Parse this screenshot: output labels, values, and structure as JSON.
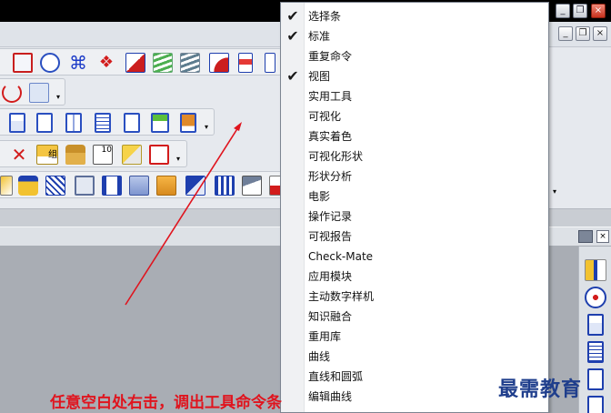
{
  "context_menu": {
    "items": [
      {
        "label": "选择条",
        "checked": true
      },
      {
        "label": "标准",
        "checked": true
      },
      {
        "label": "重复命令",
        "checked": false
      },
      {
        "label": "视图",
        "checked": true
      },
      {
        "label": "实用工具",
        "checked": false
      },
      {
        "label": "可视化",
        "checked": false
      },
      {
        "label": "真实着色",
        "checked": false
      },
      {
        "label": "可视化形状",
        "checked": false
      },
      {
        "label": "形状分析",
        "checked": false
      },
      {
        "label": "电影",
        "checked": false
      },
      {
        "label": "操作记录",
        "checked": false
      },
      {
        "label": "可视报告",
        "checked": false
      },
      {
        "label": "Check-Mate",
        "checked": false
      },
      {
        "label": "应用模块",
        "checked": false
      },
      {
        "label": "主动数字样机",
        "checked": false
      },
      {
        "label": "知识融合",
        "checked": false
      },
      {
        "label": "重用库",
        "checked": false
      },
      {
        "label": "曲线",
        "checked": false
      },
      {
        "label": "直线和圆弧",
        "checked": false
      },
      {
        "label": "编辑曲线",
        "checked": false
      }
    ]
  },
  "window_buttons": {
    "minimize": "_",
    "restore": "❐",
    "close": "×"
  },
  "annotation": {
    "caption": "任意空白处右击，调出工具命令条",
    "arrow_color": "#e0141e"
  },
  "watermark": "最需教育",
  "colors": {
    "accent_red": "#e0141e",
    "watermark_blue": "#1f3e8c"
  }
}
